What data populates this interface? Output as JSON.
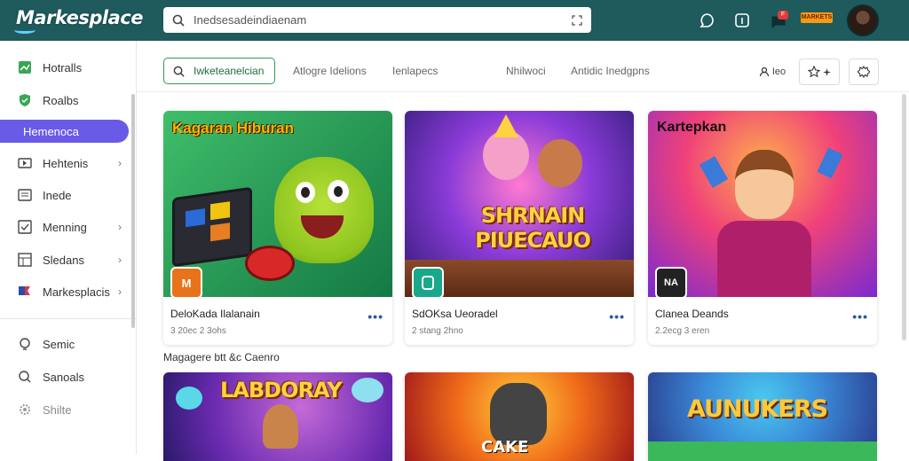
{
  "app": {
    "logo": "Markesplace"
  },
  "search": {
    "value": "Inedsesadeindiaenam"
  },
  "topbar": {
    "red_badge": "F",
    "orange_badge": "MARKETS"
  },
  "sidebar": {
    "items": [
      {
        "label": "Hotralls",
        "icon": "chart-icon",
        "chevron": false
      },
      {
        "label": "Roalbs",
        "icon": "shield-icon",
        "chevron": false
      },
      {
        "label": "Hemenoca",
        "icon": "",
        "chevron": false,
        "active": true
      },
      {
        "label": "Hehtenis",
        "icon": "video-icon",
        "chevron": true
      },
      {
        "label": "Inede",
        "icon": "list-icon",
        "chevron": false
      },
      {
        "label": "Menning",
        "icon": "check-icon",
        "chevron": true
      },
      {
        "label": "Sledans",
        "icon": "grid-icon",
        "chevron": true
      },
      {
        "label": "Markesplacis",
        "icon": "flag-icon",
        "chevron": true
      },
      {
        "label": "Semic",
        "icon": "bulb-icon",
        "chevron": false
      },
      {
        "label": "Sanoals",
        "icon": "search-icon",
        "chevron": false
      },
      {
        "label": "Shilte",
        "icon": "gear-icon",
        "chevron": false
      }
    ]
  },
  "tabs": {
    "first": "Iwketeanelcian",
    "items": [
      "Atlogre Idelions",
      "Ienlapecs",
      "Nhilwoci",
      "Antidic Inedgpns"
    ],
    "right_label": "Ieo"
  },
  "cards": [
    {
      "overlay": "Kagaran Hiburan",
      "title": "DeloKada Ilalanain",
      "sub": "3 20ec 2 3ohs",
      "badge": "M",
      "badge_color": "#e8731a"
    },
    {
      "overlay": "",
      "big": "SHRNAIN PIUECAUO",
      "title": "SdOKsa Ueoradel",
      "sub": "2 stang 2hno",
      "badge": "",
      "badge_color": "#1aa88a"
    },
    {
      "overlay": "Kartepkan",
      "title": "Clanea Deands",
      "sub": "2.2ecg 3 eren",
      "badge": "NA",
      "badge_color": "#222"
    }
  ],
  "section": {
    "label": "Magagere btt &c Caenro"
  },
  "cards_row2": [
    {
      "big": "LABDORAY"
    },
    {
      "big": "CAKE"
    },
    {
      "big": "AUNUKERS"
    }
  ],
  "colors": {
    "topbar": "#1f5a5c",
    "active": "#6a5ae8",
    "accent_green": "#2e9a5c",
    "more_dots": "#2a5aa0"
  }
}
